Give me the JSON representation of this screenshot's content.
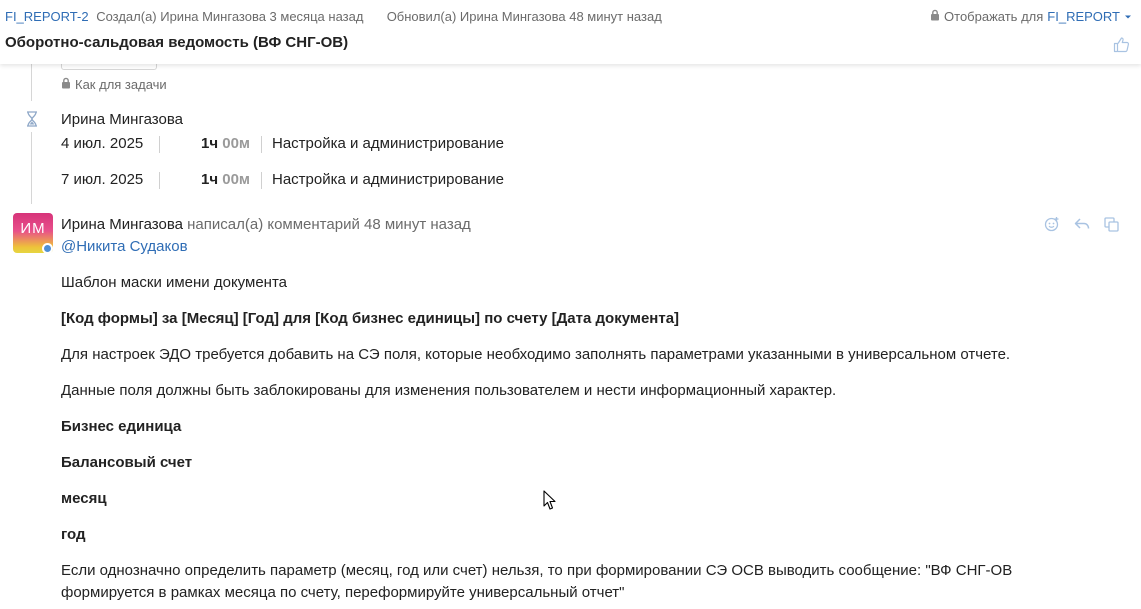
{
  "header": {
    "issue_key": "FI_REPORT-2",
    "created": "Создал(а) Ирина Мингазова 3 месяца назад",
    "updated": "Обновил(а) Ирина Мингазова 48 минут назад",
    "visibility_label": "Отображать для",
    "visibility_value": "FI_REPORT",
    "title": "Оборотно-сальдовая ведомость (ВФ СНГ-ОВ)"
  },
  "access": {
    "label": "Как для задачи"
  },
  "worklog": {
    "author": "Ирина Мингазова",
    "entries": [
      {
        "date": "4 июл. 2025",
        "hours": "1ч",
        "minutes": "00м",
        "activity": "Настройка и администрирование"
      },
      {
        "date": "7 июл. 2025",
        "hours": "1ч",
        "minutes": "00м",
        "activity": "Настройка и администрирование"
      }
    ]
  },
  "comment": {
    "avatar_initials": "ИМ",
    "author": "Ирина Мингазова",
    "action": "написал(а) комментарий",
    "time": "48 минут назад",
    "mention": "@Никита Судаков",
    "body": [
      {
        "text": "Шаблон маски имени документа",
        "bold": false
      },
      {
        "text": "[Код формы] за [Месяц] [Год] для [Код бизнес единицы] по счету [Дата документа]",
        "bold": true
      },
      {
        "text": "Для настроек ЭДО требуется добавить на СЭ поля, которые необходимо заполнять параметрами указанными в универсальном отчете.",
        "bold": false
      },
      {
        "text": "Данные поля должны быть заблокированы для изменения пользователем и нести информационный характер.",
        "bold": false
      },
      {
        "text": "Бизнес единица",
        "bold": true
      },
      {
        "text": "Балансовый счет",
        "bold": true
      },
      {
        "text": "месяц",
        "bold": true
      },
      {
        "text": "год",
        "bold": true
      },
      {
        "text": "Если однозначно определить параметр (месяц, год или счет) нельзя, то при формировании СЭ ОСВ выводить сообщение: \"ВФ СНГ-ОВ формируется в рамках месяца по счету, переформируйте универсальный отчет\"",
        "bold": false
      }
    ]
  },
  "colors": {
    "link": "#2f6db5",
    "muted": "#6b6b6b",
    "text": "#222222"
  },
  "icons": [
    "lock-icon",
    "chevron-down-icon",
    "thumbs-up-icon",
    "hourglass-icon",
    "reaction-icon",
    "reply-icon",
    "copy-icon",
    "mouse-cursor-icon"
  ]
}
